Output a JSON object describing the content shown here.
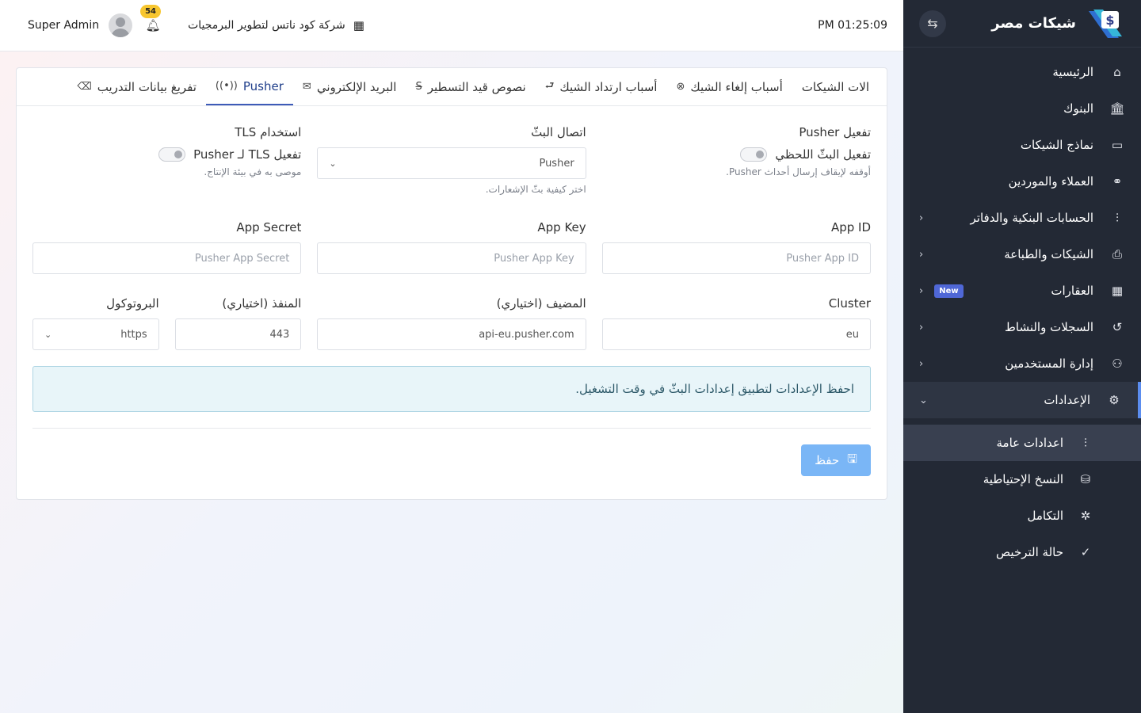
{
  "sidebar": {
    "brand": "شيكات مصر",
    "toggle_icon": "swap-arrows-icon",
    "items": [
      {
        "label": "الرئيسية",
        "icon": "home-icon"
      },
      {
        "label": "البنوك",
        "icon": "bank-icon"
      },
      {
        "label": "نماذج الشيكات",
        "icon": "banknote-icon"
      },
      {
        "label": "العملاء والموردين",
        "icon": "handshake-icon"
      },
      {
        "label": "الحسابات البنكية والدفاتر",
        "icon": "sliders-icon"
      },
      {
        "label": "الشيكات والطباعة",
        "icon": "printer-icon"
      },
      {
        "label": "العقارات",
        "icon": "building-icon",
        "badge": "New"
      },
      {
        "label": "السجلات والنشاط",
        "icon": "history-icon"
      },
      {
        "label": "إدارة المستخدمين",
        "icon": "users-icon"
      },
      {
        "label": "الإعدادات",
        "icon": "gear-icon"
      }
    ],
    "sub_items": [
      {
        "label": "اعدادات عامة",
        "icon": "adjustments-icon"
      },
      {
        "label": "النسخ الإحتياطية",
        "icon": "database-icon"
      },
      {
        "label": "التكامل",
        "icon": "plug-icon"
      },
      {
        "label": "حالة الترخيص",
        "icon": "check-circle-icon"
      }
    ],
    "accent_color": "#5b8def"
  },
  "topbar": {
    "time": "PM 01:25:09",
    "company": "شركة كود ناتس لتطوير البرمجيات",
    "notification_count": "54",
    "user_name": "Super Admin"
  },
  "tabs": [
    {
      "label": "الات الشيكات",
      "icon": ""
    },
    {
      "label": "أسباب إلغاء الشيك",
      "icon": "x-circle-icon"
    },
    {
      "label": "أسباب ارتداد الشيك",
      "icon": "return-arrow-icon"
    },
    {
      "label": "نصوص قيد التسطير",
      "icon": "strikethrough-icon"
    },
    {
      "label": "البريد الإلكتروني",
      "icon": "mail-icon"
    },
    {
      "label": "Pusher",
      "icon": "broadcast-icon"
    },
    {
      "label": "تفريغ بيانات التدريب",
      "icon": "eraser-icon"
    }
  ],
  "form": {
    "pusher_enable": {
      "label": "تفعيل Pusher",
      "toggle_label": "تفعيل البثّ اللحظي",
      "hint": "أوقفه لإيقاف إرسال أحداث Pusher."
    },
    "broadcast": {
      "label": "اتصال البثّ",
      "value": "Pusher",
      "hint": "اختر كيفية بثّ الإشعارات."
    },
    "tls": {
      "label": "استخدام TLS",
      "toggle_label": "تفعيل TLS لـ Pusher",
      "hint": "موصى به في بيئة الإنتاج."
    },
    "app_id": {
      "label": "App ID",
      "placeholder": "Pusher App ID"
    },
    "app_key": {
      "label": "App Key",
      "placeholder": "Pusher App Key"
    },
    "app_secret": {
      "label": "App Secret",
      "placeholder": "Pusher App Secret"
    },
    "cluster": {
      "label": "Cluster",
      "value": "eu"
    },
    "host": {
      "label": "المضيف (اختياري)",
      "value": "api-eu.pusher.com"
    },
    "port": {
      "label": "المنفذ (اختياري)",
      "value": "443"
    },
    "protocol": {
      "label": "البروتوكول",
      "value": "https"
    },
    "alert": "احفظ الإعدادات لتطبيق إعدادات البثّ في وقت التشغيل.",
    "save_label": "حفظ"
  }
}
